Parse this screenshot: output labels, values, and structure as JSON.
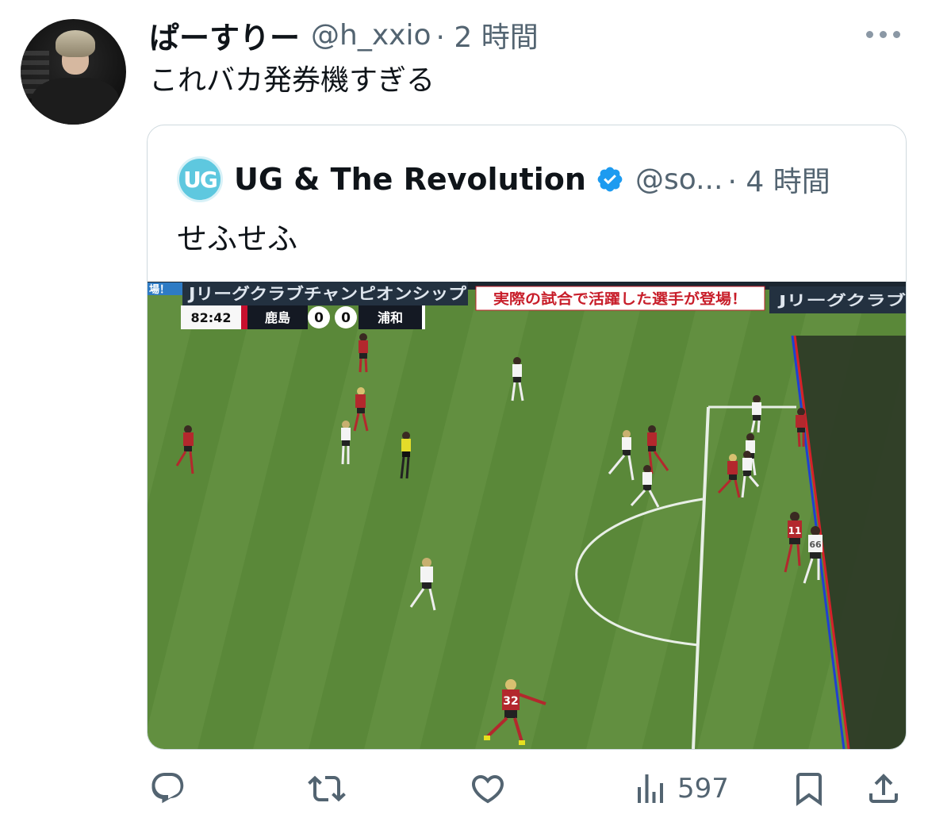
{
  "tweet": {
    "display_name": "ぱーすりー",
    "handle": "@h_xxio",
    "time": "· 2 時間",
    "text": "これバカ発券機すぎる"
  },
  "quote": {
    "avatar_text": "UG",
    "display_name": "UG & The Revolution",
    "handle": "@so...",
    "time": "· 4 時間",
    "text": "せふせふ",
    "verified": true
  },
  "media": {
    "banner_left_top": "Jリーグクラブチャンピオンシップ",
    "banner_red_text": "実際の試合で活躍した選手が登場！",
    "banner_right_top": "Jリーグクラブ",
    "banner_left_edge": "場！",
    "scoreboard": {
      "clock": "82:42",
      "home": "鹿島",
      "home_score": "0",
      "away_score": "0",
      "away": "浦和"
    },
    "shirt_numbers": [
      "11",
      "66",
      "32"
    ],
    "colors": {
      "pitch": "#5f8f3e",
      "offside_line_red": "#d6202a",
      "offside_line_blue": "#2040d0",
      "home_kit": "#b3282d",
      "away_kit": "#f4f4f4"
    }
  },
  "actions": {
    "reply_icon": "reply-icon",
    "retweet_icon": "retweet-icon",
    "like_icon": "heart-icon",
    "views_icon": "views-chart-icon",
    "views_count": "597",
    "bookmark_icon": "bookmark-icon",
    "share_icon": "share-icon",
    "icon_color": "#536471"
  }
}
